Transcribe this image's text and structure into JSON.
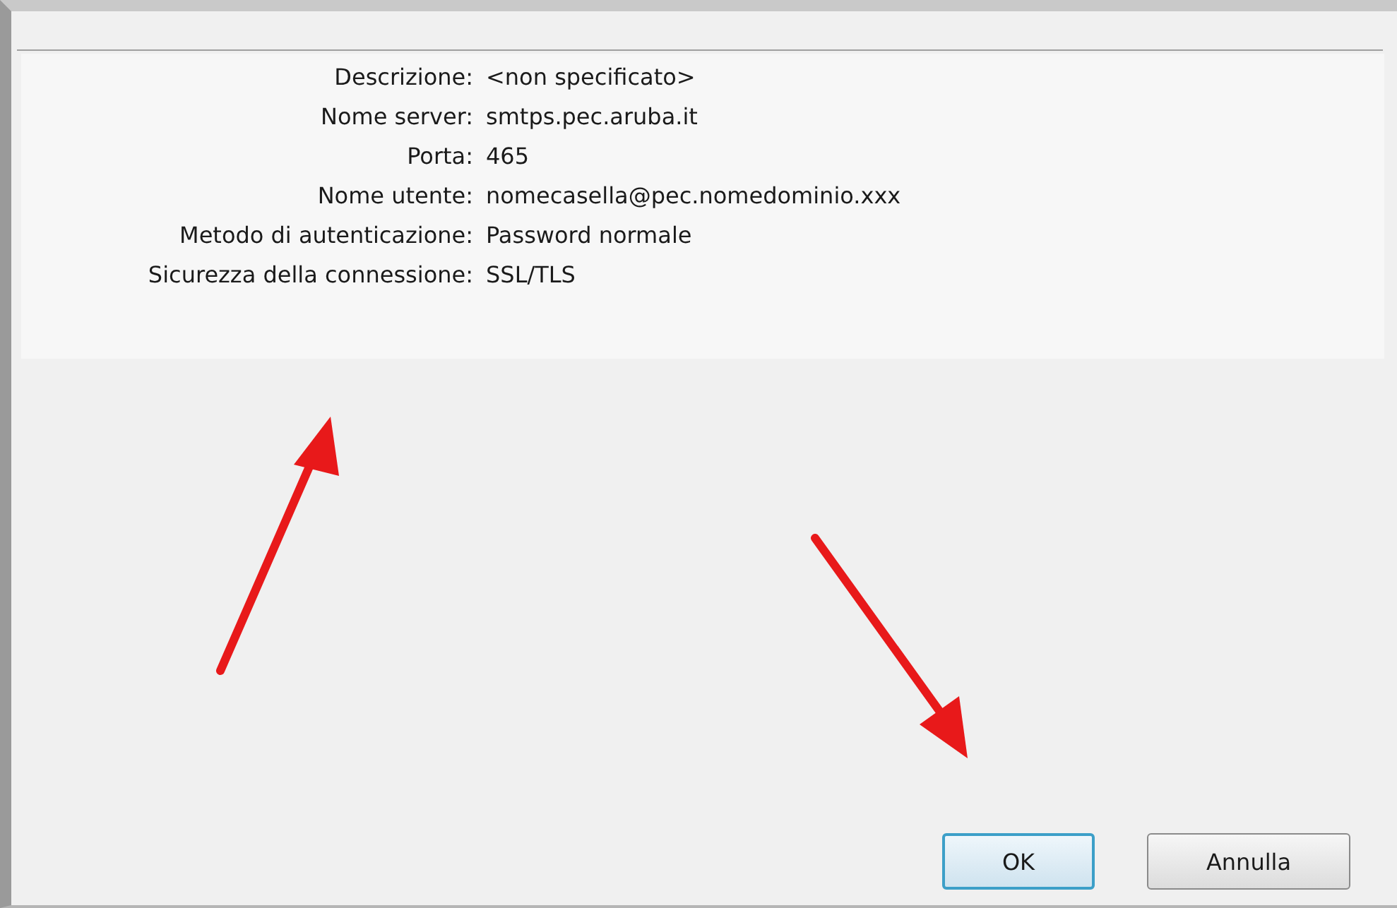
{
  "details": [
    {
      "label": "Descrizione:",
      "value": "<non specificato>"
    },
    {
      "label": "Nome server:",
      "value": "smtps.pec.aruba.it"
    },
    {
      "label": "Porta:",
      "value": "465"
    },
    {
      "label": "Nome utente:",
      "value": "nomecasella@pec.nomedominio.xxx"
    },
    {
      "label": "Metodo di autenticazione:",
      "value": "Password normale"
    },
    {
      "label": "Sicurezza della connessione:",
      "value": "SSL/TLS"
    }
  ],
  "buttons": [
    {
      "label": "OK",
      "default": true
    },
    {
      "label": "Annulla",
      "default": false
    }
  ]
}
